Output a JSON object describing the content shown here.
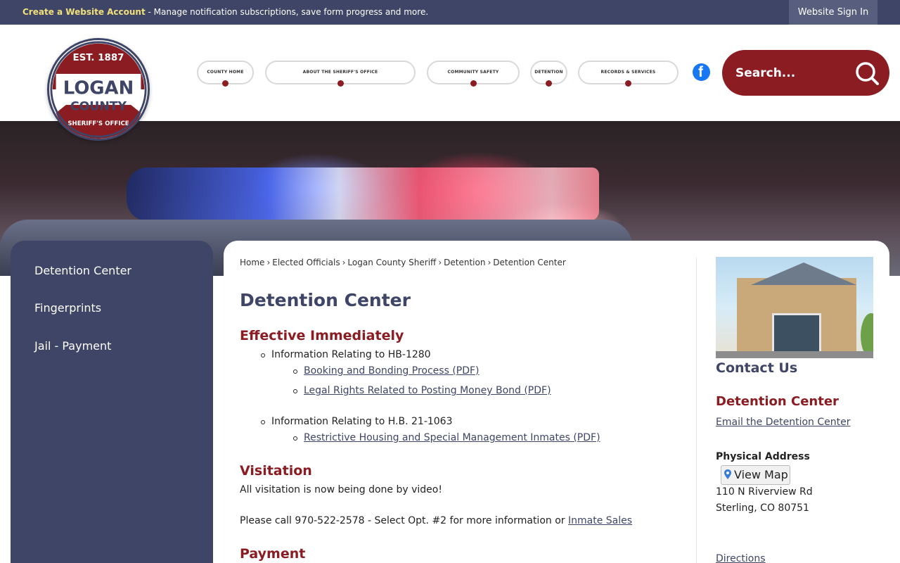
{
  "topbar": {
    "create_account": "Create a Website Account",
    "promo_text": " - Manage notification subscriptions, save form progress and more.",
    "signin": "Website Sign In"
  },
  "logo": {
    "line1": "EST. 1887",
    "line2": "LOGAN",
    "line3": "COUNTY",
    "line4": "SHERIFF'S OFFICE"
  },
  "nav": [
    {
      "label": "COUNTY HOME"
    },
    {
      "label": "ABOUT THE SHERIFF'S OFFICE"
    },
    {
      "label": "COMMUNITY SAFETY"
    },
    {
      "label": "DETENTION"
    },
    {
      "label": "RECORDS & SERVICES"
    }
  ],
  "search": {
    "placeholder": "Search..."
  },
  "sidebar": {
    "items": [
      {
        "label": "Detention Center"
      },
      {
        "label": "Fingerprints"
      },
      {
        "label": "Jail - Payment"
      }
    ]
  },
  "breadcrumb": [
    "Home",
    "Elected Officials",
    "Logan County Sheriff",
    "Detention",
    "Detention Center"
  ],
  "main": {
    "title": "Detention Center",
    "effective": {
      "heading": "Effective Immediately",
      "item1": "Information Relating to HB-1280",
      "link1": "Booking and Bonding Process (PDF)",
      "link2": "Legal Rights Related to Posting Money Bond (PDF)",
      "item2": "Information Relating to H.B. 21-1063",
      "link3": "Restrictive Housing and Special Management Inmates (PDF)"
    },
    "visitation": {
      "heading": "Visitation",
      "line1": "All visitation is now being done by video!",
      "line2": "Please call 970-522-2578 - Select Opt. #2 for more information or ",
      "link": "Inmate Sales"
    },
    "payment": {
      "heading": "Payment"
    }
  },
  "contact": {
    "title": "Contact Us",
    "name": "Detention Center",
    "email": "Email the Detention Center",
    "address_label": "Physical Address",
    "map_button": "View Map",
    "street": "110 N Riverview Rd",
    "city": "Sterling, CO 80751",
    "directions": "Directions"
  },
  "colors": {
    "navy": "#3f4566",
    "maroon": "#8a1c22",
    "facebook": "#1877f2"
  },
  "icons": {
    "search": "search-icon",
    "facebook": "facebook-icon",
    "map_pin": "map-pin-icon"
  }
}
